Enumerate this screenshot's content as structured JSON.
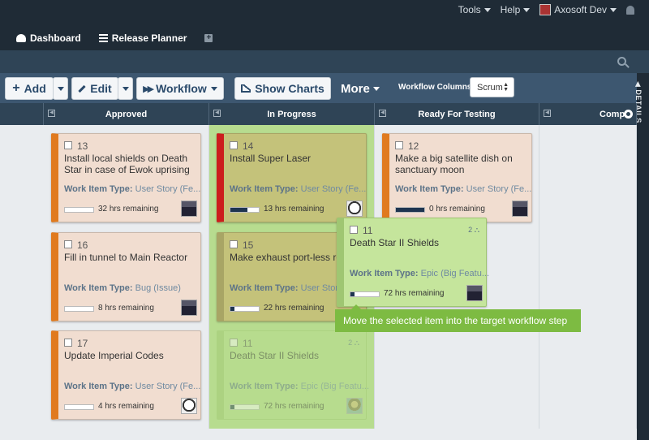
{
  "header": {
    "tools_label": "Tools",
    "help_label": "Help",
    "user_name": "Axosoft Dev"
  },
  "nav": {
    "dashboard_label": "Dashboard",
    "release_planner_label": "Release Planner"
  },
  "toolbar": {
    "add_label": "Add",
    "edit_label": "Edit",
    "workflow_label": "Workflow",
    "show_charts_label": "Show Charts",
    "more_label": "More",
    "workflow_columns_label": "Workflow Columns:",
    "workflow_columns_value": "Scrum"
  },
  "details_label": "DETAILS",
  "columns": [
    {
      "label": "Approved"
    },
    {
      "label": "In Progress"
    },
    {
      "label": "Ready For Testing"
    },
    {
      "label": "Comp"
    }
  ],
  "cards": {
    "c13": {
      "number": "13",
      "title": "Install local shields on Death Star in case of Ewok uprising",
      "type_label": "Work Item Type:",
      "type_value": "User Story (Fe...",
      "remaining": "32 hrs remaining",
      "progress": 0
    },
    "c16": {
      "number": "16",
      "title": "Fill in tunnel to Main Reactor",
      "type_label": "Work Item Type:",
      "type_value": "Bug (Issue)",
      "remaining": "8 hrs remaining",
      "progress": 0
    },
    "c17": {
      "number": "17",
      "title": "Update Imperial Codes",
      "type_label": "Work Item Type:",
      "type_value": "User Story (Fe...",
      "remaining": "4 hrs remaining",
      "progress": 0
    },
    "c14": {
      "number": "14",
      "title": "Install Super Laser",
      "type_label": "Work Item Type:",
      "type_value": "User Story (Fe...",
      "remaining": "13 hrs remaining",
      "progress": 0.6
    },
    "c15": {
      "number": "15",
      "title": "Make exhaust port-less reactor",
      "type_label": "Work Item Type:",
      "type_value": "User Story",
      "remaining": "22 hrs remaining",
      "progress": 0.15
    },
    "c11ghost": {
      "number": "11",
      "title": "Death Star II Shields",
      "type_label": "Work Item Type:",
      "type_value": "Epic (Big Featu...",
      "remaining": "72 hrs remaining",
      "progress": 0.15,
      "sub_count": "2"
    },
    "c12": {
      "number": "12",
      "title": "Make a big satellite dish on sanctuary moon",
      "type_label": "Work Item Type:",
      "type_value": "User Story (Fe...",
      "remaining": "0 hrs remaining",
      "progress": 1
    },
    "c11drag": {
      "number": "11",
      "title": "Death Star II Shields",
      "type_label": "Work Item Type:",
      "type_value": "Epic (Big Featu...",
      "remaining": "72 hrs remaining",
      "progress": 0.15,
      "sub_count": "2"
    }
  },
  "tooltip_text": "Move the selected item into the target workflow step",
  "colors": {
    "topbar": "#1f2b36",
    "toolbar": "#3d5770",
    "card_bg": "#f1ddd0",
    "stripe_orange": "#e07a1f",
    "stripe_red": "#cc1d1d",
    "highlight_green": "#b7dc8f",
    "tooltip_green": "#7dbb42"
  }
}
